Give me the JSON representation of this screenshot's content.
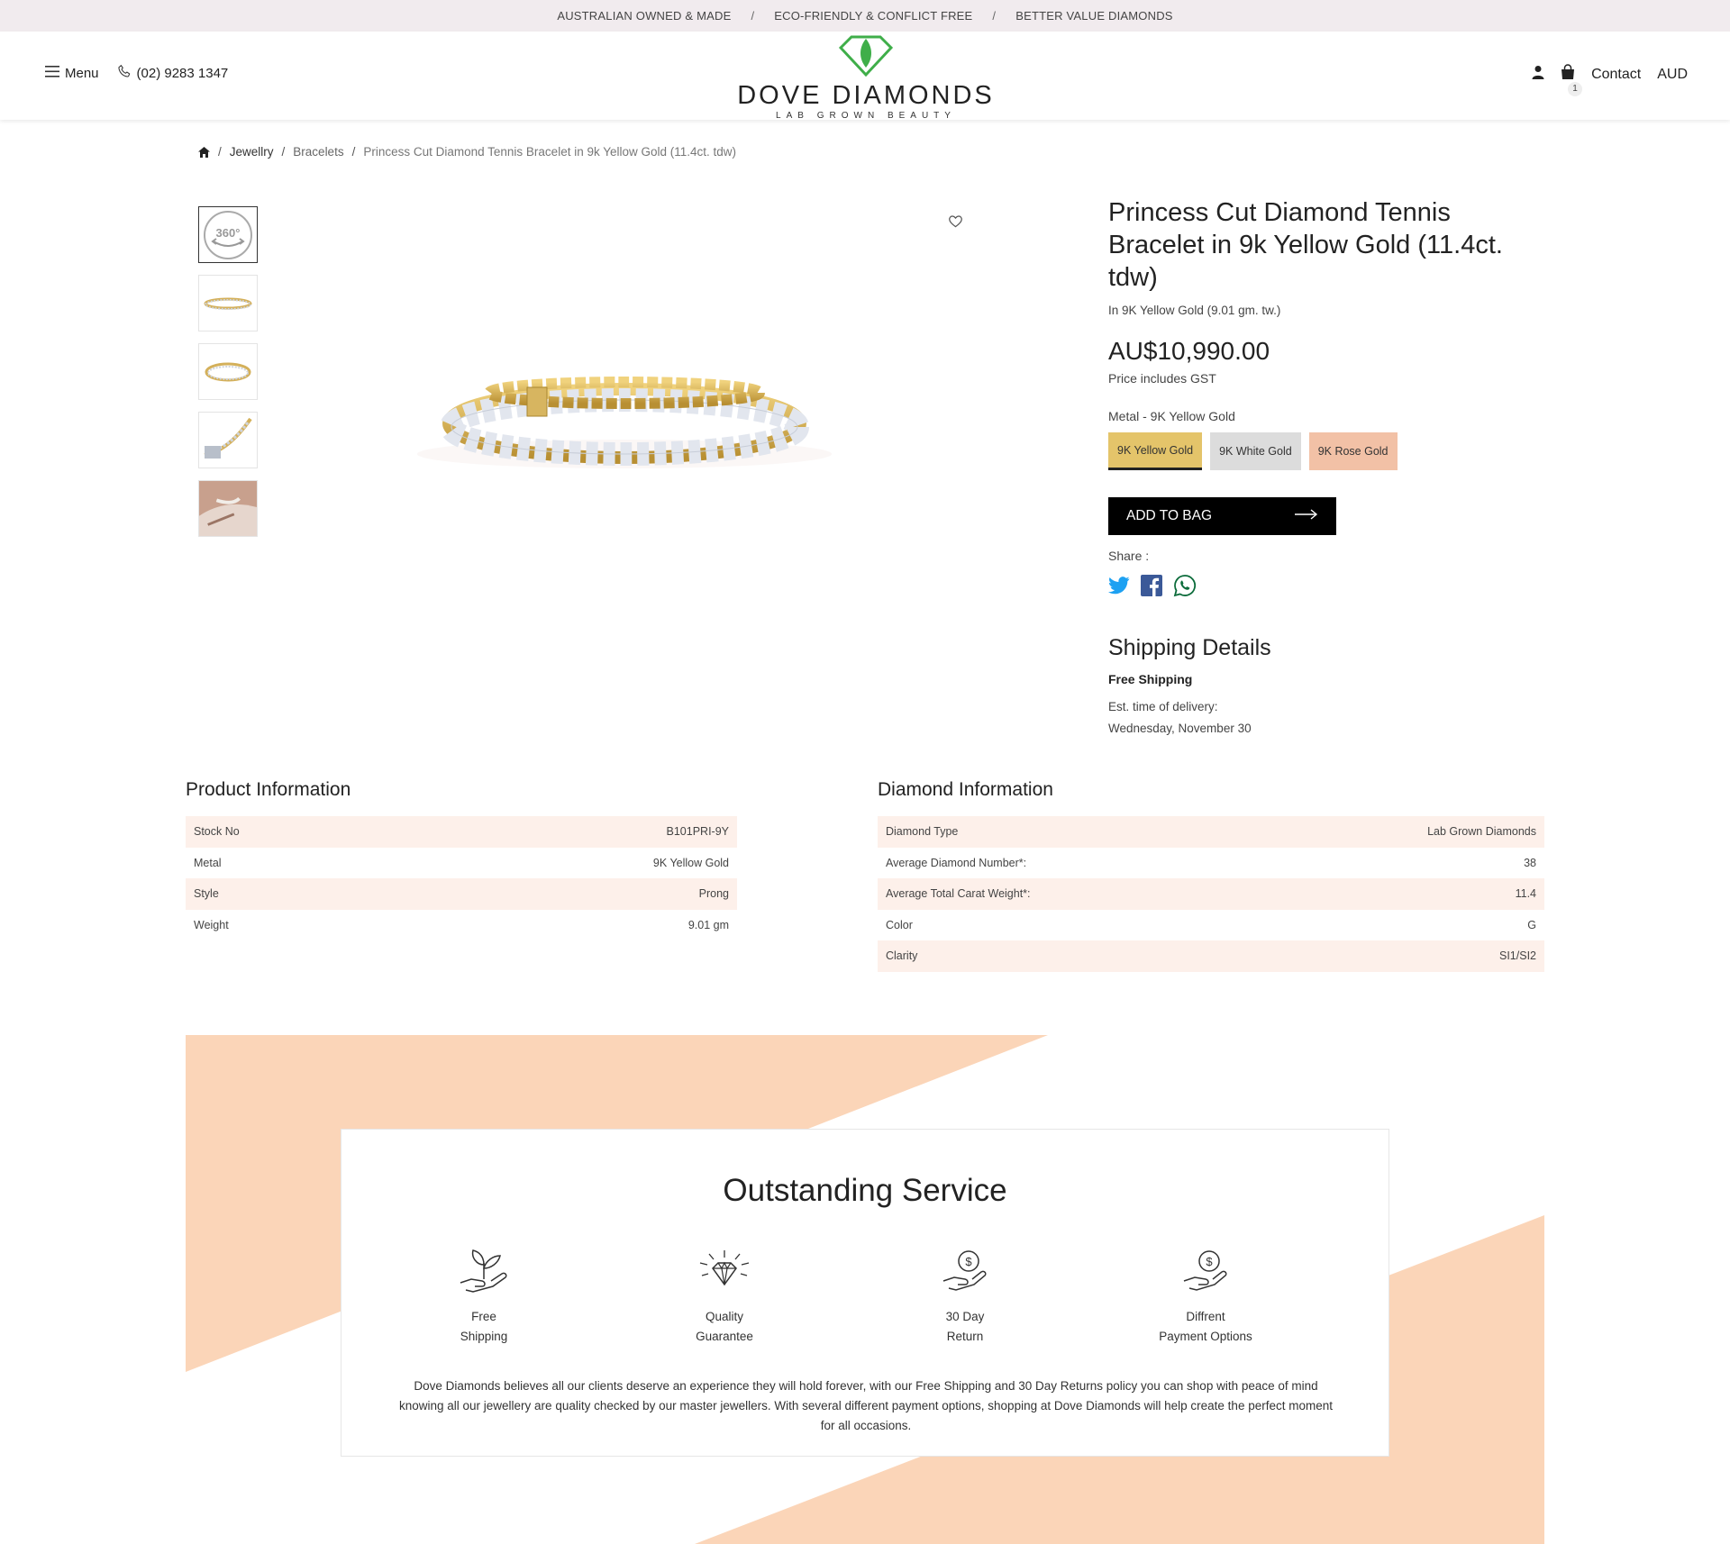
{
  "topbar": {
    "items": [
      "AUSTRALIAN OWNED & MADE",
      "ECO-FRIENDLY & CONFLICT FREE",
      "BETTER VALUE DIAMONDS"
    ],
    "separator": "/"
  },
  "header": {
    "menu_label": "Menu",
    "phone": "(02) 9283 1347",
    "logo_name": "DOVE DIAMONDS",
    "logo_tagline": "LAB GROWN BEAUTY",
    "cart_count": "1",
    "contact_label": "Contact",
    "currency": "AUD"
  },
  "breadcrumb": {
    "items": [
      "Jewellry",
      "Bracelets"
    ],
    "separator": "/",
    "current": "Princess Cut Diamond Tennis Bracelet in 9k Yellow Gold (11.4ct. tdw)"
  },
  "gallery": {
    "spin_label": "360°"
  },
  "product": {
    "title": "Princess Cut Diamond Tennis Bracelet in 9k Yellow Gold (11.4ct. tdw)",
    "subtitle": "In 9K Yellow Gold (9.01 gm. tw.)",
    "price": "AU$10,990.00",
    "price_note": "Price includes GST",
    "metal_label": "Metal - 9K Yellow Gold",
    "metal_options": [
      "9K Yellow Gold",
      "9K White Gold",
      "9K Rose Gold"
    ],
    "selected_metal": "9K Yellow Gold",
    "add_to_bag": "ADD TO BAG",
    "share_label": "Share :"
  },
  "shipping": {
    "title": "Shipping Details",
    "free_label": "Free Shipping",
    "est_label": "Est. time of delivery:",
    "est_date": "Wednesday, November 30"
  },
  "product_info": {
    "title": "Product Information",
    "rows": [
      {
        "label": "Stock No",
        "value": "B101PRI-9Y"
      },
      {
        "label": "Metal",
        "value": "9K Yellow Gold"
      },
      {
        "label": "Style",
        "value": "Prong"
      },
      {
        "label": "Weight",
        "value": "9.01 gm"
      }
    ]
  },
  "diamond_info": {
    "title": "Diamond Information",
    "rows": [
      {
        "label": "Diamond Type",
        "value": "Lab Grown Diamonds"
      },
      {
        "label": "Average Diamond Number*:",
        "value": "38"
      },
      {
        "label": "Average Total Carat Weight*:",
        "value": "11.4"
      },
      {
        "label": "Color",
        "value": "G"
      },
      {
        "label": "Clarity",
        "value": "SI1/SI2"
      }
    ]
  },
  "service": {
    "title": "Outstanding Service",
    "items": [
      {
        "line1": "Free",
        "line2": "Shipping",
        "icon": "plant-hand-icon"
      },
      {
        "line1": "Quality",
        "line2": "Guarantee",
        "icon": "diamond-sparkle-icon"
      },
      {
        "line1": "30 Day",
        "line2": "Return",
        "icon": "money-return-hand-icon"
      },
      {
        "line1": "Diffrent",
        "line2": "Payment Options",
        "icon": "money-hand-icon"
      }
    ],
    "text": "Dove Diamonds believes all our clients deserve an experience they will hold forever, with our Free Shipping and 30 Day Returns policy you can shop with peace of mind knowing all our jewellery are quality checked by our master jewellers. With several different payment options, shopping at Dove Diamonds will help create the perfect moment for all occasions."
  },
  "colors": {
    "accent_peach": "#fbd5b8",
    "yellow_gold": "#e4c46a",
    "white_gold": "#dcdcdc",
    "rose_gold": "#f2c1a6",
    "logo_green": "#3fae49",
    "table_shade": "#fdf0ea"
  }
}
